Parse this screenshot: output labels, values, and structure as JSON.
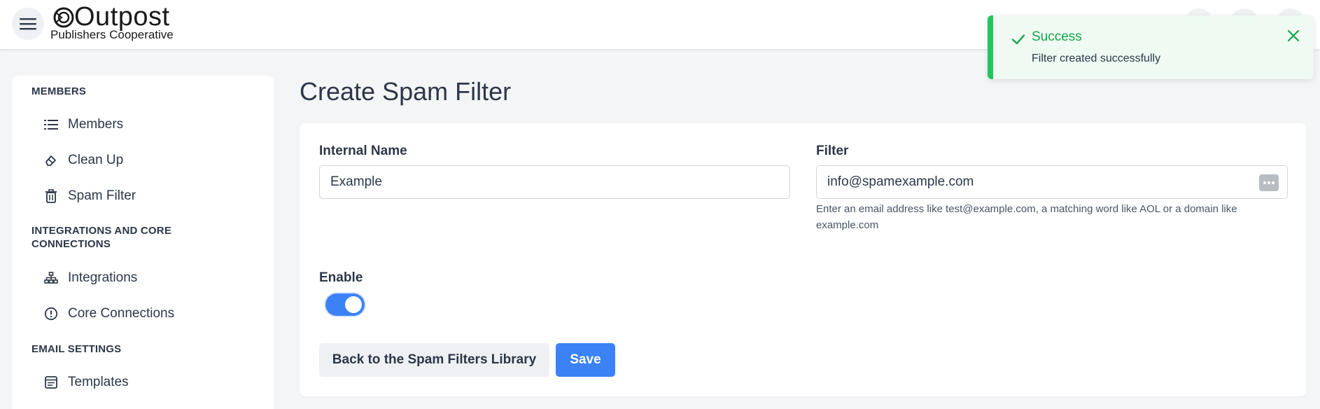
{
  "header": {
    "logo_title": "Outpost",
    "logo_subtitle": "Publishers Cooperative"
  },
  "sidebar": {
    "sections": [
      {
        "title": "MEMBERS"
      },
      {
        "title": "INTEGRATIONS AND CORE CONNECTIONS"
      },
      {
        "title": "EMAIL SETTINGS"
      }
    ],
    "items": [
      {
        "label": "Members",
        "icon": "list-icon"
      },
      {
        "label": "Clean Up",
        "icon": "eraser-icon"
      },
      {
        "label": "Spam Filter",
        "icon": "trash-icon"
      },
      {
        "label": "Integrations",
        "icon": "sitemap-icon"
      },
      {
        "label": "Core Connections",
        "icon": "alert-circle-icon"
      },
      {
        "label": "Templates",
        "icon": "template-icon"
      }
    ]
  },
  "main": {
    "page_title": "Create Spam Filter",
    "internal_name": {
      "label": "Internal Name",
      "value": "Example"
    },
    "filter": {
      "label": "Filter",
      "value": "info@spamexample.com",
      "help": "Enter an email address like test@example.com, a matching word like AOL or a domain like example.com"
    },
    "enable": {
      "label": "Enable",
      "on": true
    },
    "buttons": {
      "back": "Back to the Spam Filters Library",
      "save": "Save"
    }
  },
  "toast": {
    "title": "Success",
    "message": "Filter created successfully"
  },
  "colors": {
    "accent": "#3b82f6",
    "success": "#16a34a",
    "success_bar": "#22c55e"
  }
}
